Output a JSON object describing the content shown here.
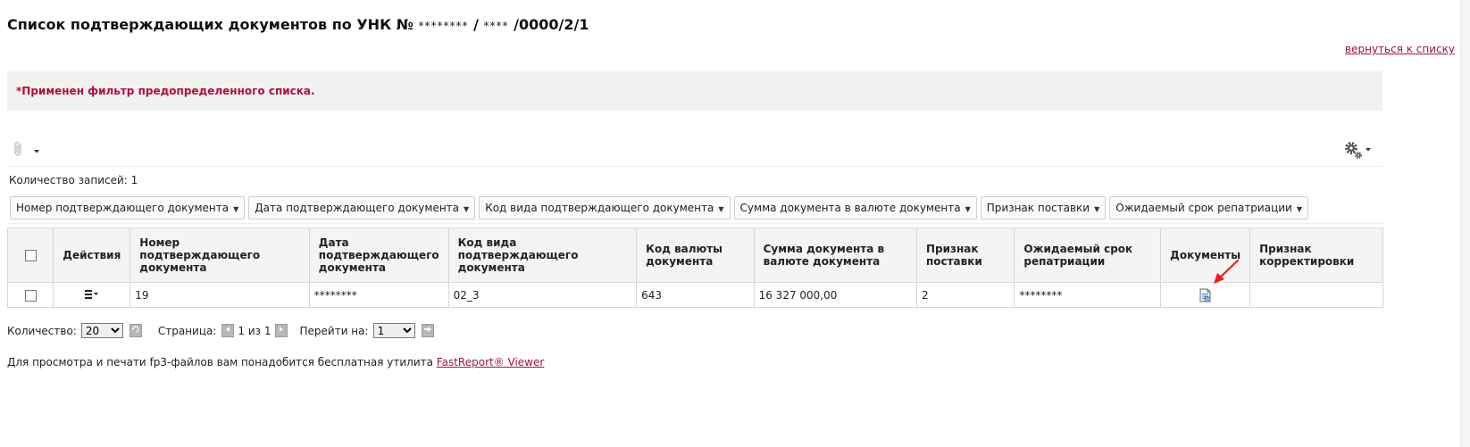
{
  "header": {
    "title_prefix": "Список подтверждающих документов по УНК №",
    "unk_mask1": "********",
    "sep": "/",
    "unk_mask2": "****",
    "unk_suffix": "/0000/2/1",
    "back_link": "вернуться к списку"
  },
  "filter": {
    "message": "*Применен фильтр предопределенного списка."
  },
  "toolbar": {
    "attach_icon": "paperclip-icon",
    "settings_icon": "gear-icon"
  },
  "records": {
    "label": "Количество записей:",
    "count": "1"
  },
  "filter_chips": [
    "Номер подтверждающего документа",
    "Дата подтверждающего документа",
    "Код вида подтверждающего документа",
    "Сумма документа в валюте документа",
    "Признак поставки",
    "Ожидаемый срок репатриации"
  ],
  "table": {
    "columns": [
      "Действия",
      "Номер подтверждающего документа",
      "Дата подтверждающего документа",
      "Код вида подтверждающего документа",
      "Код валюты документа",
      "Сумма документа в валюте документа",
      "Признак поставки",
      "Ожидаемый срок репатриации",
      "Документы",
      "Признак корректировки"
    ],
    "rows": [
      {
        "actions_icon": "menu-icon",
        "number": "19",
        "date": "********",
        "type_code": "02_3",
        "currency": "643",
        "amount": "16 327 000,00",
        "delivery": "2",
        "repatriation": "********",
        "documents_icon": "document-icon",
        "correction": ""
      }
    ]
  },
  "pager": {
    "count_label": "Количество:",
    "count_value": "20",
    "page_label": "Страница:",
    "page_text": "1 из 1",
    "goto_label": "Перейти на:",
    "goto_value": "1"
  },
  "footer": {
    "note": "Для просмотра и печати fp3-файлов вам понадобится бесплатная утилита",
    "link": "FastReport® Viewer"
  },
  "colors": {
    "accent": "#a0153e",
    "arrow": "#e8201a"
  }
}
